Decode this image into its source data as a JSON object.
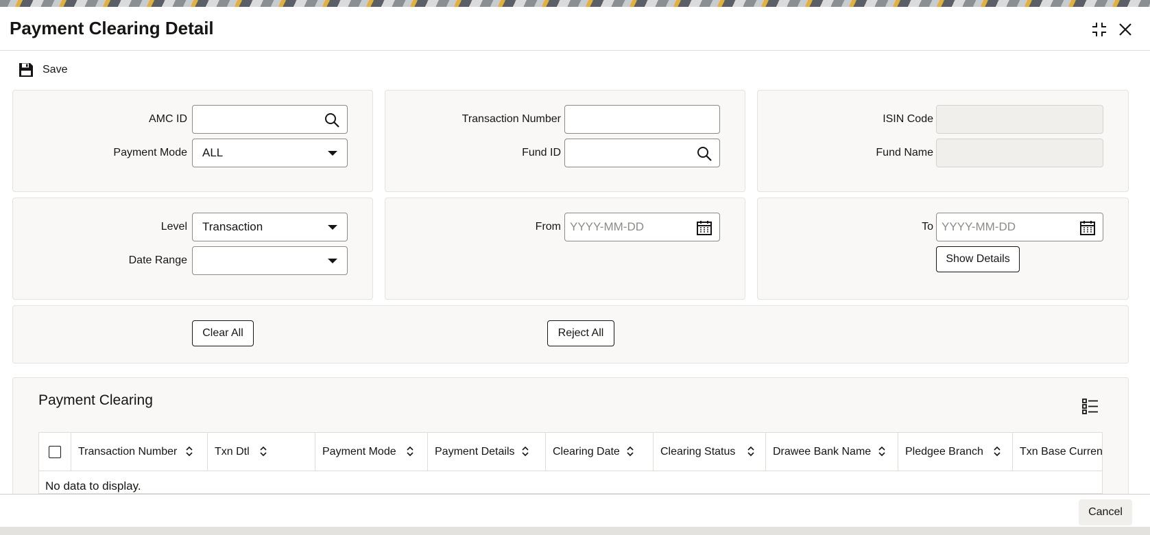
{
  "window": {
    "title": "Payment Clearing Detail"
  },
  "toolbar": {
    "save_label": "Save"
  },
  "form": {
    "amc_id": {
      "label": "AMC ID",
      "value": ""
    },
    "payment_mode": {
      "label": "Payment Mode",
      "value": "ALL"
    },
    "transaction_number": {
      "label": "Transaction Number",
      "value": ""
    },
    "fund_id": {
      "label": "Fund ID",
      "value": ""
    },
    "isin_code": {
      "label": "ISIN Code",
      "value": ""
    },
    "fund_name": {
      "label": "Fund Name",
      "value": ""
    },
    "level": {
      "label": "Level",
      "value": "Transaction"
    },
    "date_range": {
      "label": "Date Range",
      "value": ""
    },
    "from": {
      "label": "From",
      "placeholder": "YYYY-MM-DD"
    },
    "to": {
      "label": "To",
      "placeholder": "YYYY-MM-DD"
    },
    "show_details_label": "Show Details",
    "clear_all_label": "Clear All",
    "reject_all_label": "Reject All"
  },
  "grid": {
    "title": "Payment Clearing",
    "columns": [
      "Transaction Number",
      "Txn Dtl",
      "Payment Mode",
      "Payment Details",
      "Clearing Date",
      "Clearing Status",
      "Drawee Bank Name",
      "Pledgee Branch",
      "Txn Base Currency"
    ],
    "empty_message": "No data to display."
  },
  "footer": {
    "cancel_label": "Cancel"
  },
  "icons": {
    "save": "save-icon",
    "minimize": "collapse-icon",
    "close": "close-icon",
    "search": "search-icon",
    "calendar": "calendar-icon",
    "list": "list-view-icon",
    "dropdown": "chevron-down-icon",
    "sort": "sort-icon"
  }
}
